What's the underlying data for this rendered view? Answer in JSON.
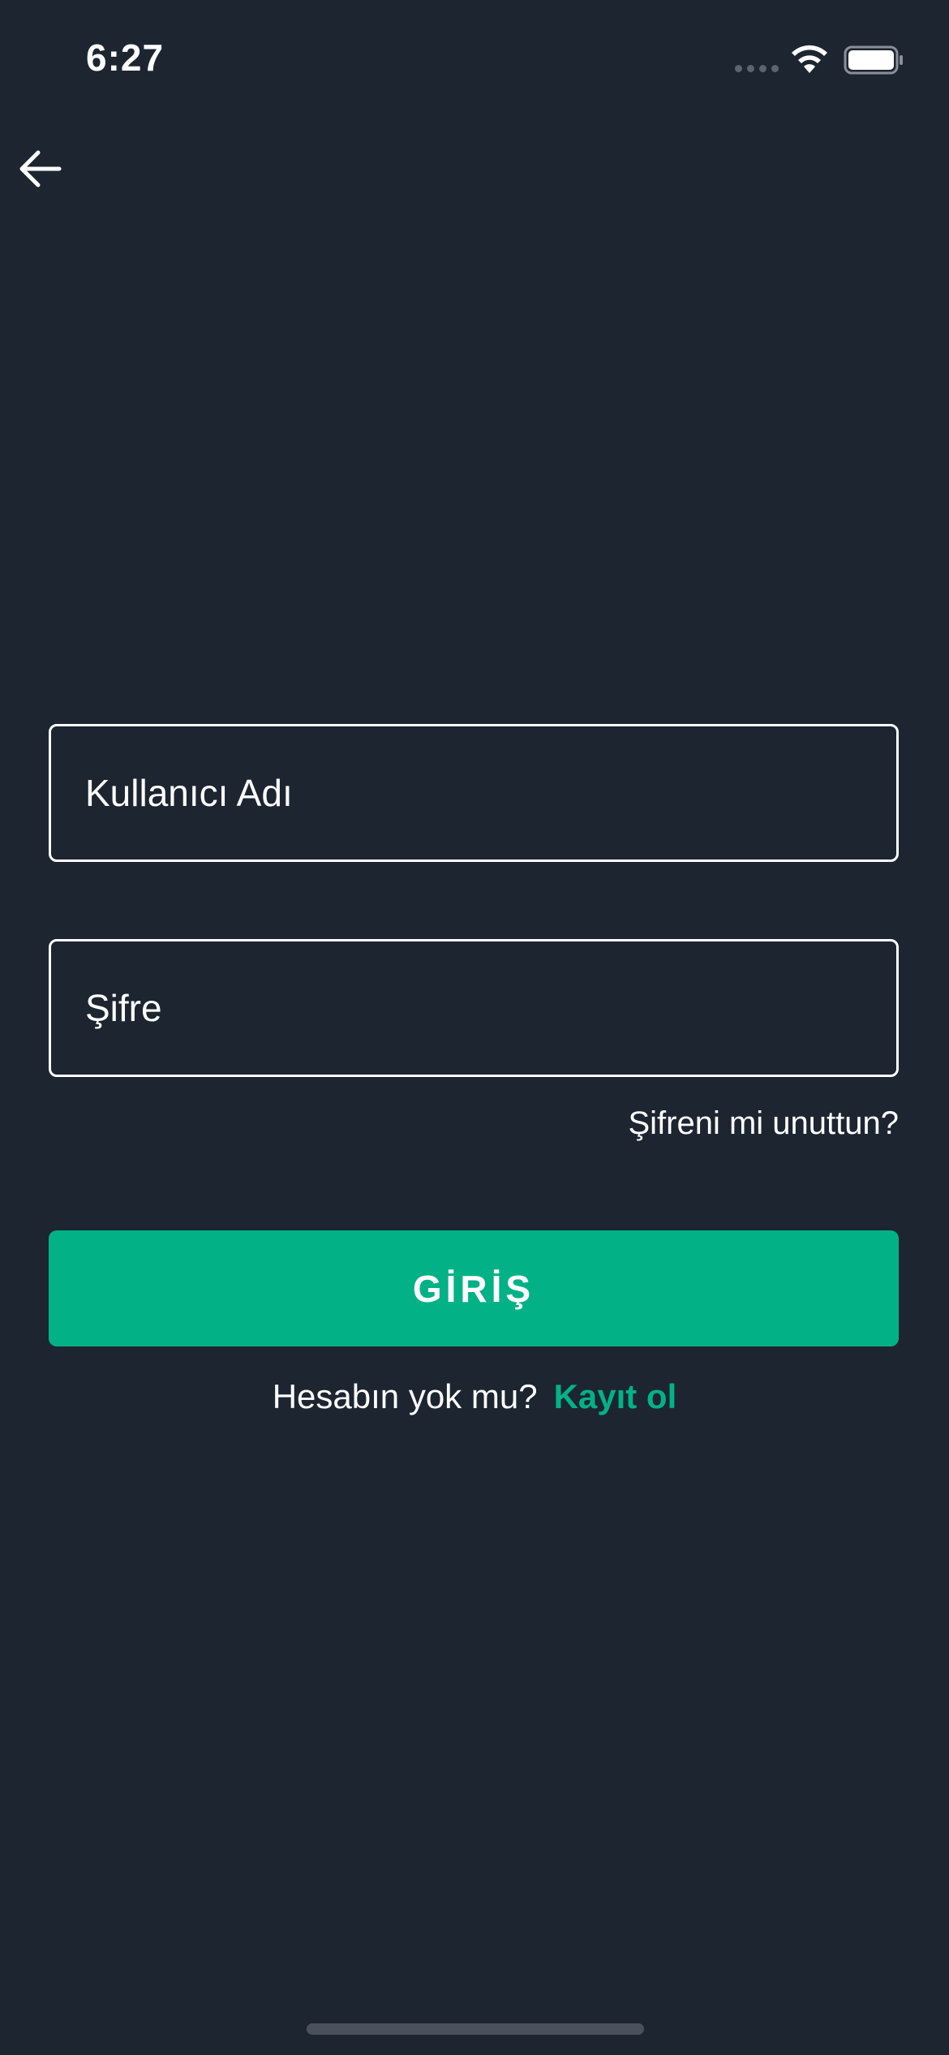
{
  "status_bar": {
    "time": "6:27"
  },
  "nav": {
    "back_icon": "arrow-left-icon"
  },
  "form": {
    "username_placeholder": "Kullanıcı Adı",
    "password_placeholder": "Şifre",
    "forgot_password": "Şifreni mi unuttun?",
    "login_label": "GİRİŞ"
  },
  "signup": {
    "question": "Hesabın yok mu?",
    "link_label": "Kayıt ol"
  },
  "colors": {
    "background": "#1d2531",
    "accent": "#02b286"
  }
}
